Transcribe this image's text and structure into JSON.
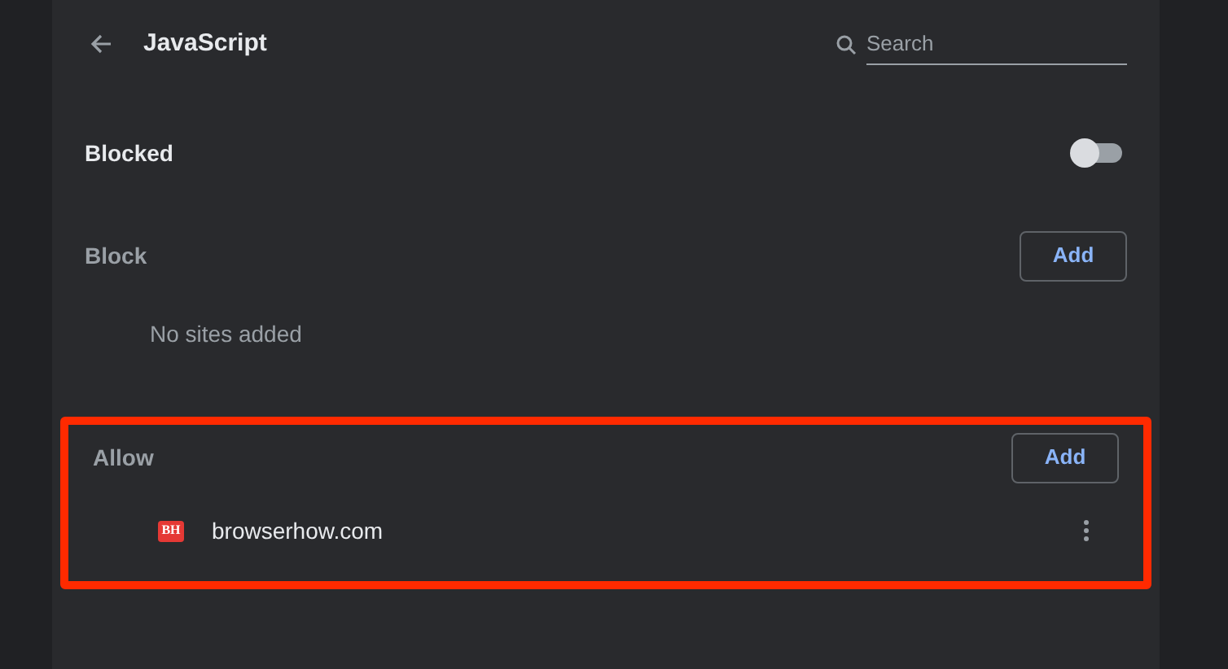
{
  "header": {
    "title": "JavaScript",
    "search": {
      "placeholder": "Search"
    }
  },
  "blocked_setting": {
    "label": "Blocked",
    "on": false
  },
  "sections": [
    {
      "title": "Block",
      "button": "Add",
      "highlighted": false,
      "empty_text": "No sites added"
    },
    {
      "title": "Allow",
      "button": "Add",
      "highlighted": true,
      "sites": [
        {
          "favicon_text": "BH",
          "name": "browserhow.com"
        }
      ]
    }
  ]
}
